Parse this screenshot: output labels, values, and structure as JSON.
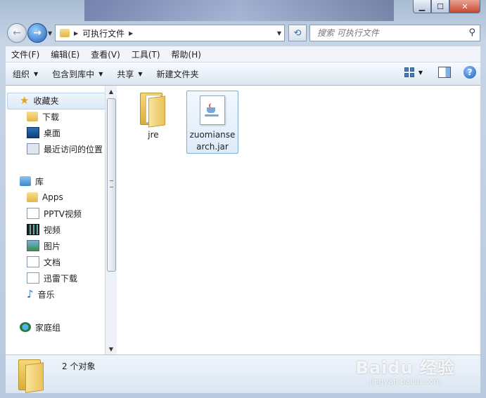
{
  "window": {
    "minimize": "▁",
    "maximize": "☐",
    "close": "✕"
  },
  "nav": {
    "back": "←",
    "forward": "→",
    "path": "可执行文件",
    "search_placeholder": "搜索 可执行文件"
  },
  "menu": [
    "文件(F)",
    "编辑(E)",
    "查看(V)",
    "工具(T)",
    "帮助(H)"
  ],
  "toolbar": {
    "organize": "组织",
    "include_in_library": "包含到库中",
    "share": "共享",
    "new_folder": "新建文件夹",
    "help": "?"
  },
  "sidebar": {
    "favorites": {
      "label": "收藏夹",
      "items": [
        "下载",
        "桌面",
        "最近访问的位置"
      ]
    },
    "libraries": {
      "label": "库",
      "items": [
        "Apps",
        "PPTV视频",
        "视频",
        "图片",
        "文档",
        "迅雷下载",
        "音乐"
      ]
    },
    "homegroup": "家庭组"
  },
  "files": [
    {
      "name": "jre",
      "type": "folder",
      "selected": false
    },
    {
      "name": "zuomiansearch.jar",
      "type": "jar",
      "selected": true
    }
  ],
  "details": {
    "count_text": "2 个对象"
  },
  "watermark": {
    "main": "Baidu 经验",
    "sub": "jingyan.baidu.com"
  },
  "colors": {
    "accent": "#2561b8",
    "selection": "#dceaf8"
  }
}
